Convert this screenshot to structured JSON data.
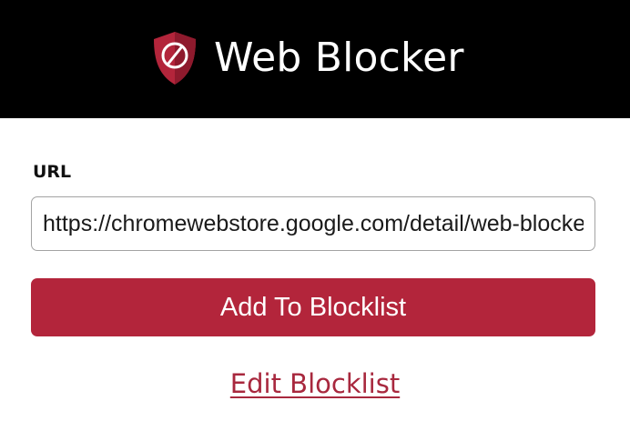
{
  "header": {
    "app_title": "Web Blocker",
    "logo_icon": "shield-blocked-icon",
    "background_color": "#000000"
  },
  "form": {
    "url_label": "URL",
    "url_value": "https://chromewebstore.google.com/detail/web-blocker",
    "add_button_label": "Add To Blocklist",
    "edit_link_label": "Edit Blocklist"
  },
  "colors": {
    "accent": "#b3253b",
    "link": "#a8283e"
  }
}
